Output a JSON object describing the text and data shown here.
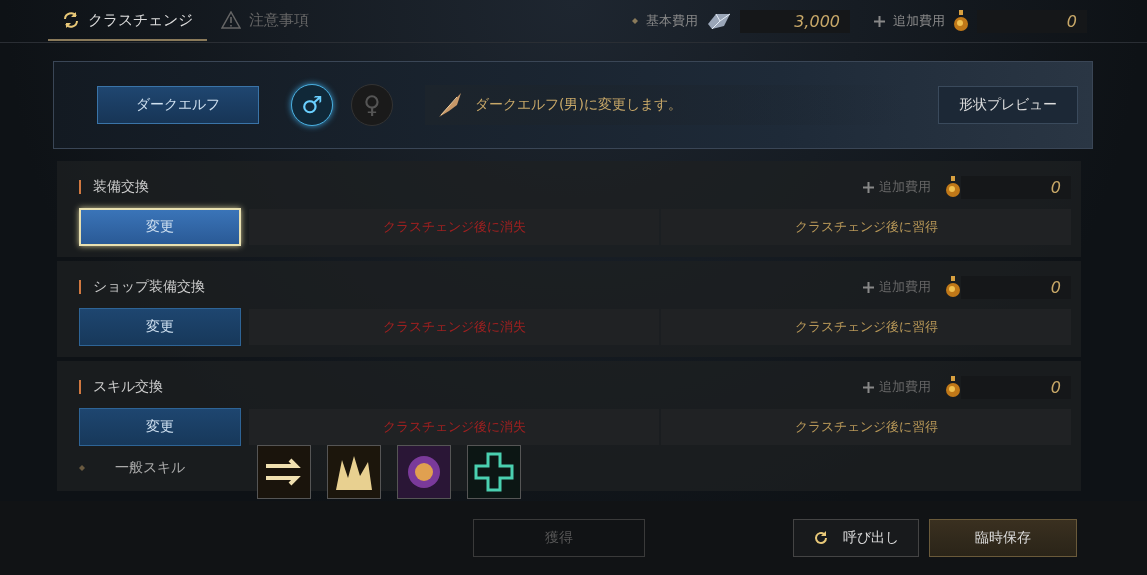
{
  "tabs": [
    {
      "label": "クラスチェンジ",
      "kind": "refresh",
      "selected": true
    },
    {
      "label": "注意事項",
      "kind": "warning",
      "selected": false
    }
  ],
  "costs": [
    {
      "label": "基本費用",
      "kind": "crystal",
      "value": "3,000"
    },
    {
      "label": "追加費用",
      "kind": "potion",
      "value": "0"
    }
  ],
  "race": {
    "button": "ダークエルフ",
    "genders": [
      {
        "symbol": "♂",
        "selected": true
      },
      {
        "symbol": "♀",
        "selected": false
      }
    ],
    "message": "ダークエルフ(男)に変更します。",
    "preview": "形状プレビュー"
  },
  "sections": [
    {
      "title": "装備交換",
      "cost_label": "追加費用",
      "cost": "0",
      "button": "変更",
      "selected": true,
      "lost": "クラスチェンジ後に消失",
      "learned": "クラスチェンジ後に習得"
    },
    {
      "title": "ショップ装備交換",
      "cost_label": "追加費用",
      "cost": "0",
      "button": "変更",
      "selected": false,
      "lost": "クラスチェンジ後に消失",
      "learned": "クラスチェンジ後に習得"
    },
    {
      "title": "スキル交換",
      "cost_label": "追加費用",
      "cost": "0",
      "button": "変更",
      "selected": false,
      "lost": "クラスチェンジ後に消失",
      "learned": "クラスチェンジ後に習得",
      "skill_group": "一般スキル",
      "skills": [
        {
          "kind": "arrow"
        },
        {
          "kind": "claw"
        },
        {
          "kind": "emblem"
        },
        {
          "kind": "cross"
        }
      ]
    }
  ],
  "footer": [
    {
      "label": "獲得",
      "kind": "plain",
      "disabled": true
    },
    {
      "label": "呼び出し",
      "kind": "recall",
      "disabled": false
    },
    {
      "label": "臨時保存",
      "kind": "save",
      "disabled": false
    }
  ]
}
